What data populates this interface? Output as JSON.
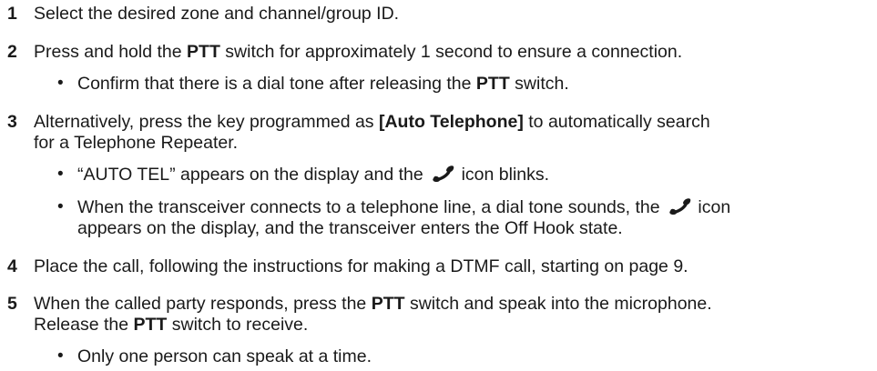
{
  "steps": [
    {
      "number": "1",
      "text": "Select the desired zone and channel/group ID."
    },
    {
      "number": "2",
      "text_a": "Press and hold the ",
      "bold_a": "PTT",
      "text_b": " switch for approximately 1 second to ensure a connection.",
      "bullets": [
        {
          "text_a": "Confirm that there is a dial tone after releasing the ",
          "bold_a": "PTT",
          "text_b": " switch."
        }
      ]
    },
    {
      "number": "3",
      "text_a": "Alternatively, press the key programmed as ",
      "bold_a": "[Auto Telephone]",
      "text_b": " to automatically search",
      "line2": "for a Telephone Repeater.",
      "bullets": [
        {
          "text_a": "“AUTO TEL” appears on the display and the ",
          "icon": "telephone-handset-icon",
          "text_b": " icon blinks."
        },
        {
          "text_a": "When the transceiver connects to a telephone line, a dial tone sounds, the ",
          "icon": "telephone-handset-icon",
          "text_b": " icon",
          "line2": "appears on the display, and the transceiver enters the Off Hook state."
        }
      ]
    },
    {
      "number": "4",
      "text": "Place the call, following the instructions for making a DTMF call, starting on page 9."
    },
    {
      "number": "5",
      "text_a": "When the called party responds, press the ",
      "bold_a": "PTT",
      "text_b": " switch and speak into the microphone.",
      "line2_a": "Release the ",
      "line2_bold": "PTT",
      "line2_b": " switch to receive.",
      "bullets": [
        {
          "text": "Only one person can speak at a time."
        }
      ]
    }
  ],
  "bullet_char": "•"
}
